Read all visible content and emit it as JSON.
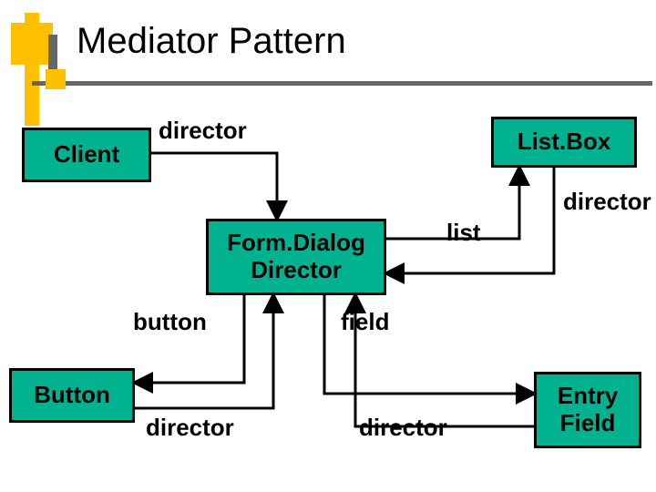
{
  "title": "Mediator Pattern",
  "boxes": {
    "client": "Client",
    "listbox": "List.Box",
    "formdialog": "Form.Dialog Director",
    "button": "Button",
    "entryfield": "Entry Field"
  },
  "labels": {
    "director_top": "director",
    "director_right": "director",
    "button_lbl": "button",
    "field_lbl": "field",
    "director_btn_left": "director",
    "director_btn_right": "director",
    "list_lbl": "list"
  },
  "colors": {
    "box_fill": "#00b28f",
    "accent": "#ffc000",
    "line": "#000000"
  }
}
